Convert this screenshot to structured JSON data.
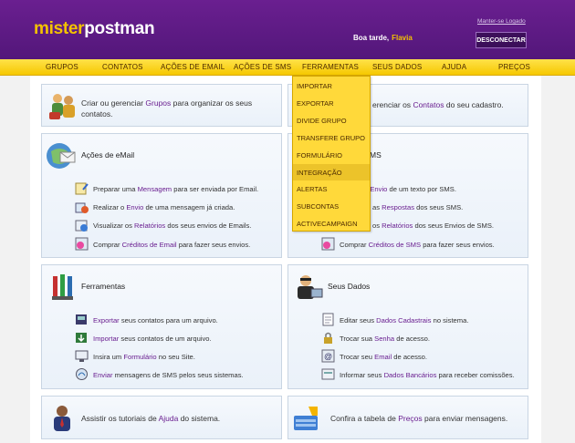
{
  "header": {
    "logo_part1": "mister",
    "logo_part2": "postman",
    "keep_logged": "Manter-se Logado",
    "greeting": "Boa tarde,",
    "user_name": "Flavia",
    "disconnect": "DESCONECTAR"
  },
  "nav": {
    "items": [
      "GRUPOS",
      "CONTATOS",
      "AÇÕES DE EMAIL",
      "AÇÕES DE SMS",
      "FERRAMENTAS",
      "SEUS DADOS",
      "AJUDA",
      "PREÇOS"
    ]
  },
  "dropdown": {
    "items": [
      "IMPORTAR",
      "EXPORTAR",
      "DIVIDE GRUPO",
      "TRANSFERE GRUPO",
      "FORMULÁRIO",
      "INTEGRAÇÃO",
      "ALERTAS",
      "SUBCONTAS",
      "ACTIVECAMPAIGN"
    ],
    "active_index": 5
  },
  "groups_box": {
    "pre": "Criar ou gerenciar",
    "link": "Grupos",
    "post": "para organizar os seus",
    "line2": "contatos."
  },
  "contacts_box": {
    "pre": "erenciar os",
    "link": "Contatos",
    "post": "do seu cadastro."
  },
  "email_box": {
    "title": "Ações de eMail",
    "items": [
      {
        "pre": "Preparar uma",
        "link": "Mensagem",
        "post": "para ser enviada por Email."
      },
      {
        "pre": "Realizar o",
        "link": "Envio",
        "post": "de uma mensagem já criada."
      },
      {
        "pre": "Visualizar os",
        "link": "Relatórios",
        "post": "dos seus envios de Emails."
      },
      {
        "pre": "Comprar",
        "link": "Créditos de Email",
        "post": "para fazer seus envios."
      }
    ]
  },
  "sms_box": {
    "title_tail": "MS",
    "items": [
      {
        "pre": "o",
        "link": "Envio",
        "post": "de um texto por SMS."
      },
      {
        "pre": "as",
        "link": "Respostas",
        "post": "dos seus SMS."
      },
      {
        "pre": "os",
        "link": "Relatórios",
        "post": "dos seus Envios de SMS."
      },
      {
        "pre": "Comprar",
        "link": "Créditos de SMS",
        "post": "para fazer seus envios."
      }
    ]
  },
  "tools_box": {
    "title": "Ferramentas",
    "items": [
      {
        "pre": "",
        "link": "Exportar",
        "post": "seus contatos para um arquivo."
      },
      {
        "pre": "",
        "link": "Importar",
        "post": "seus contatos de um arquivo."
      },
      {
        "pre": "Insira um",
        "link": "Formulário",
        "post": "no seu Site."
      },
      {
        "pre": "",
        "link": "Enviar",
        "post": "mensagens de SMS pelos seus sistemas."
      }
    ]
  },
  "data_box": {
    "title": "Seus Dados",
    "items": [
      {
        "pre": "Editar seus",
        "link": "Dados Cadastrais",
        "post": "no sistema."
      },
      {
        "pre": "Trocar sua",
        "link": "Senha",
        "post": "de acesso."
      },
      {
        "pre": "Trocar seu",
        "link": "Email",
        "post": "de acesso."
      },
      {
        "pre": "Informar seus",
        "link": "Dados Bancários",
        "post": "para receber comissões."
      }
    ]
  },
  "help_box": {
    "pre": "Assistir os tutoriais de",
    "link": "Ajuda",
    "post": "do sistema."
  },
  "prices_box": {
    "pre": "Confira a tabela de",
    "link": "Preços",
    "post": "para enviar mensagens."
  },
  "colors": {
    "header_purple": "#5a1a82",
    "accent_yellow": "#f4c300",
    "link_purple": "#6a1f90"
  }
}
